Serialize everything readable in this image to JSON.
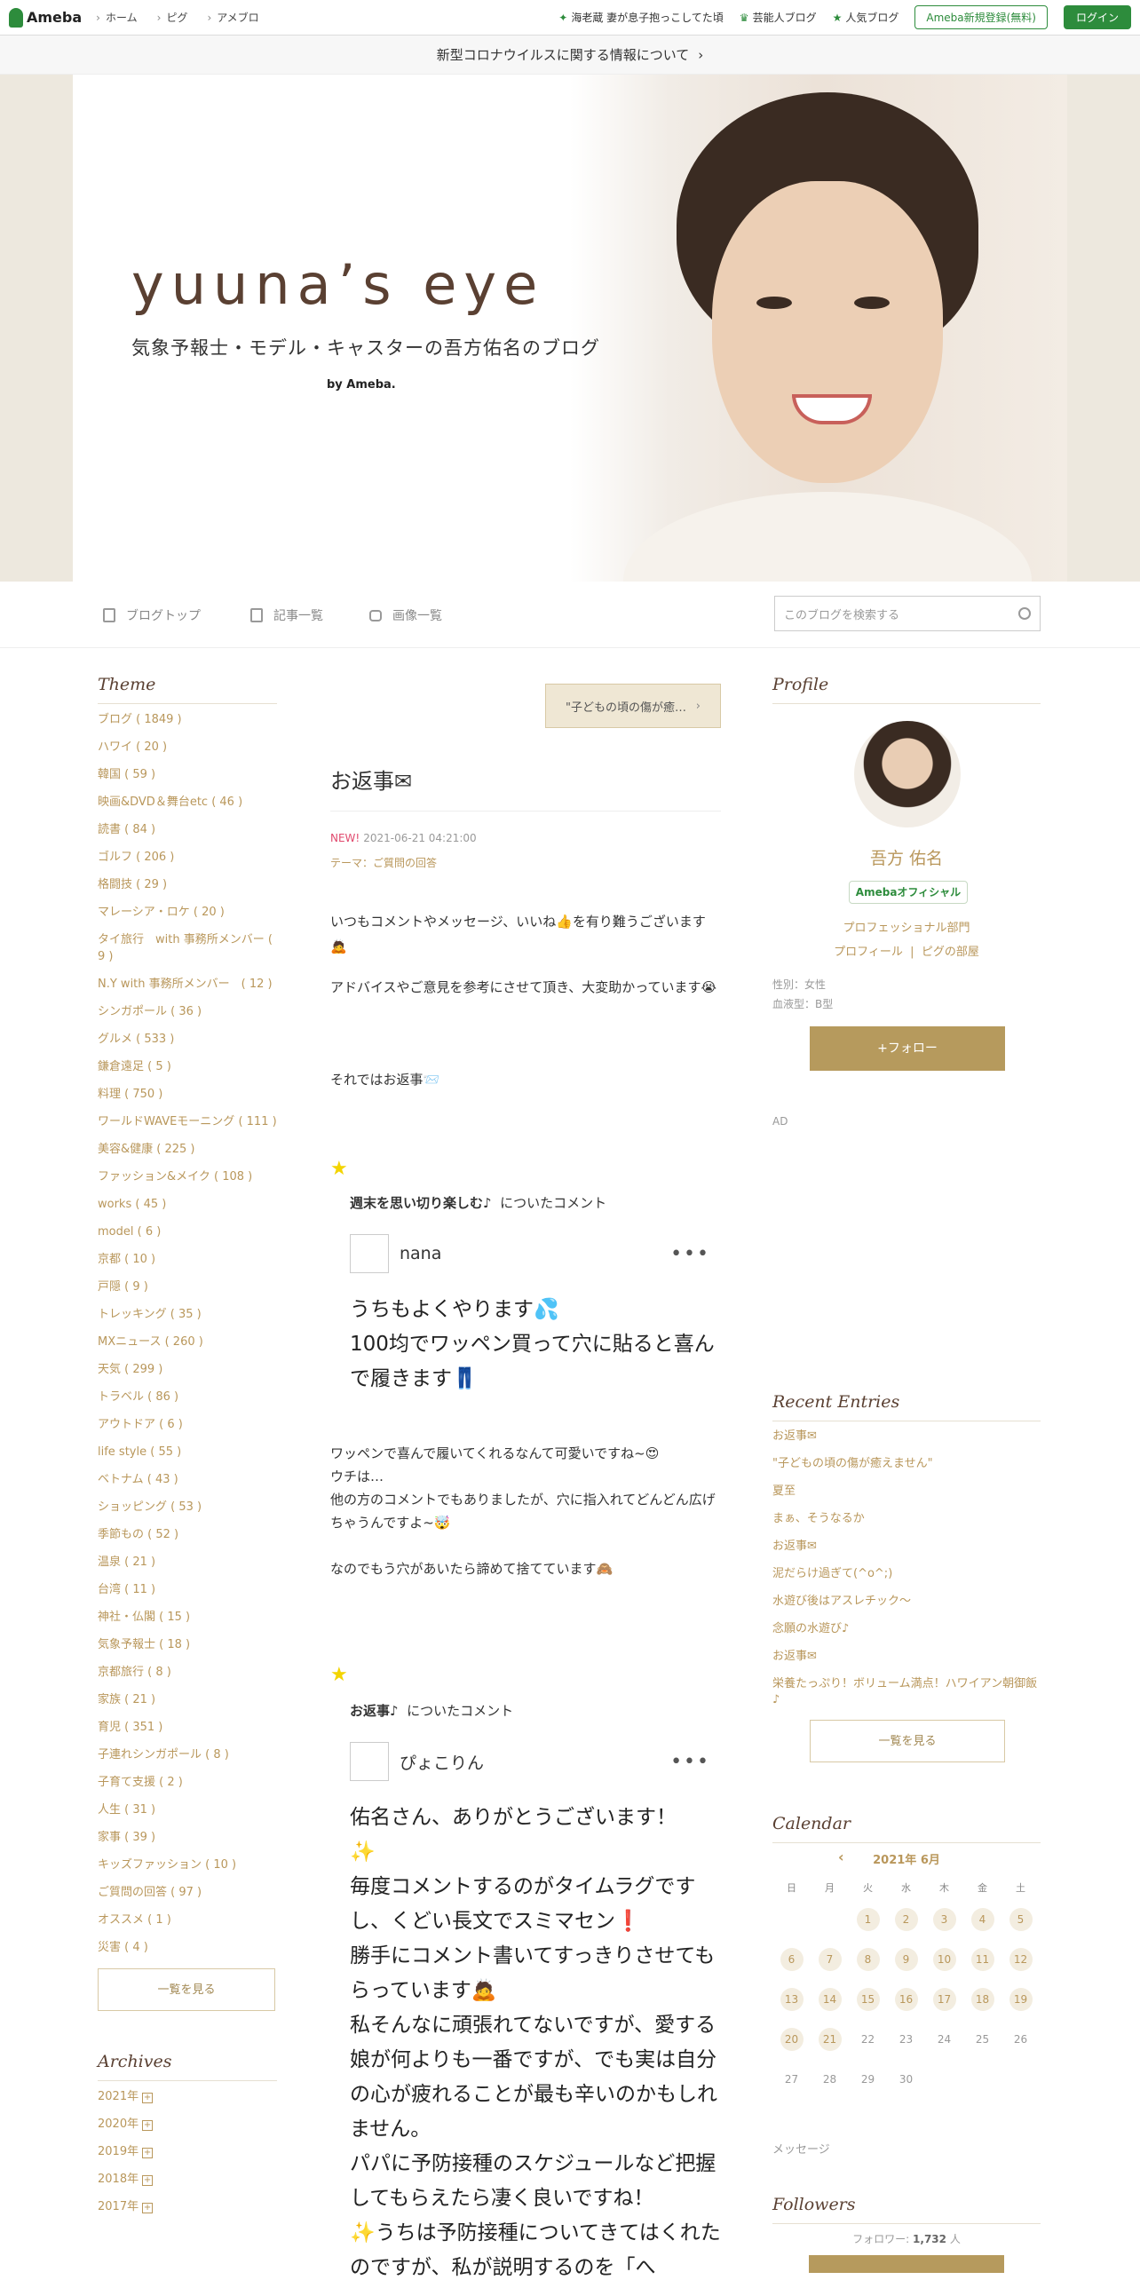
{
  "topbar": {
    "logo": "Ameba",
    "nav": [
      "ホーム",
      "ピグ",
      "アメブロ"
    ],
    "links": [
      "海老蔵 妻が息子抱っこしてた頃",
      "芸能人ブログ",
      "人気ブログ"
    ],
    "register": "Ameba新規登録(無料)",
    "login": "ログイン"
  },
  "notice": "新型コロナウイルスに関する情報について",
  "header": {
    "title": "yuuna’s eye",
    "subtitle": "気象予報士・モデル・キャスターの吾方佑名のブログ",
    "by": "by Ameba."
  },
  "tabs": {
    "top": "ブログトップ",
    "entries": "記事一覧",
    "images": "画像一覧",
    "search_placeholder": "このブログを検索する"
  },
  "theme": {
    "heading": "Theme",
    "items": [
      "ブログ ( 1849 )",
      "ハワイ ( 20 )",
      "韓国 ( 59 )",
      "映画&DVD＆舞台etc ( 46 )",
      "読書 ( 84 )",
      "ゴルフ ( 206 )",
      "格闘技 ( 29 )",
      "マレーシア・ロケ ( 20 )",
      "タイ旅行　with 事務所メンバー ( 9 )",
      "N.Y with 事務所メンバー　( 12 )",
      "シンガポール ( 36 )",
      "グルメ ( 533 )",
      "鎌倉遠足 ( 5 )",
      "料理 ( 750 )",
      "ワールドWAVEモーニング ( 111 )",
      "美容&健康 ( 225 )",
      "ファッション&メイク ( 108 )",
      "works ( 45 )",
      "model ( 6 )",
      "京都 ( 10 )",
      "戸隠 ( 9 )",
      "トレッキング ( 35 )",
      "MXニュース ( 260 )",
      "天気 ( 299 )",
      "トラベル ( 86 )",
      "アウトドア ( 6 )",
      "life style ( 55 )",
      "ベトナム ( 43 )",
      "ショッピング ( 53 )",
      "季節もの ( 52 )",
      "温泉 ( 21 )",
      "台湾 ( 11 )",
      "神社・仏閣 ( 15 )",
      "気象予報士 ( 18 )",
      "京都旅行 ( 8 )",
      "家族 ( 21 )",
      "育児 ( 351 )",
      "子連れシンガポール ( 8 )",
      "子育て支援 ( 2 )",
      "人生 ( 31 )",
      "家事 ( 39 )",
      "キッズファッション ( 10 )",
      "ご質問の回答 ( 97 )",
      "オススメ ( 1 )",
      "災害 ( 4 )"
    ],
    "more": "一覧を見る"
  },
  "archives": {
    "heading": "Archives",
    "items": [
      "2021年",
      "2020年",
      "2019年",
      "2018年",
      "2017年"
    ]
  },
  "post": {
    "prev": "\"子どもの頃の傷が癒…",
    "title": "お返事✉",
    "new": "NEW!",
    "date": "2021-06-21 04:21:00",
    "theme": "テーマ：ご質問の回答",
    "p1": "いつもコメントやメッセージ、いいね👍を有り難うございます🙇",
    "p2": "アドバイスやご意見を参考にさせて頂き、大変助かっています😭",
    "p3": "それではお返事📨",
    "c1": {
      "head_bold": "週末を思い切り楽しむ♪",
      "head_rest": "についたコメント",
      "user": "nana",
      "text": "うちもよくやります💦\n100均でワッペン買って穴に貼ると喜んで履きます👖"
    },
    "r1": "ワッペンで喜んで履いてくれるなんて可愛いですね~😍\nウチは…\n他の方のコメントでもありましたが、穴に指入れてどんどん広げちゃうんですよ~🤯\n\nなのでもう穴があいたら諦めて捨てています🙈",
    "c2": {
      "head_bold": "お返事♪",
      "head_rest": "についたコメント",
      "user": "ぴょこりん",
      "text": "佑名さん、ありがとうございます！\n✨\n毎度コメントするのがタイムラグですし、くどい長文でスミマセン❗\n勝手にコメント書いてすっきりさせてもらっています🙇\n私そんなに頑張れてないですが、愛する娘が何よりも一番ですが、でも実は自分の心が疲れることが最も辛いのかもしれません。\nパパに予防接種のスケジュールなど把握してもらえたら凄く良いですね！\n✨うちは予防接種についてきてはくれたのですが、私が説明するのを「へ"
    }
  },
  "profile": {
    "heading": "Profile",
    "name": "吾方 佑名",
    "badge": "Amebaオフィシャル",
    "section": "プロフェッショナル部門",
    "profile_link": "プロフィール",
    "pig_link": "ピグの部屋",
    "gender": "性別：女性",
    "blood": "血液型：B型",
    "follow": "+フォロー",
    "ad": "AD"
  },
  "recent": {
    "heading": "Recent Entries",
    "items": [
      "お返事✉",
      "\"子どもの頃の傷が癒えません\"",
      "夏至",
      "まぁ、そうなるか",
      "お返事✉",
      "泥だらけ過ぎて(^o^;)",
      "水遊び後はアスレチック～",
      "念願の水遊び♪",
      "お返事✉",
      "栄養たっぷり！ボリューム満点！ハワイアン朝御飯♪"
    ],
    "more": "一覧を見る"
  },
  "calendar": {
    "heading": "Calendar",
    "month": "2021年 6月",
    "dow": [
      "日",
      "月",
      "火",
      "水",
      "木",
      "金",
      "土"
    ],
    "days": [
      "",
      "",
      "1",
      "2",
      "3",
      "4",
      "5",
      "6",
      "7",
      "8",
      "9",
      "10",
      "11",
      "12",
      "13",
      "14",
      "15",
      "16",
      "17",
      "18",
      "19",
      "20",
      "21",
      "22",
      "23",
      "24",
      "25",
      "26",
      "27",
      "28",
      "29",
      "30",
      "",
      "",
      ""
    ],
    "has_entries": [
      1,
      2,
      3,
      4,
      5,
      6,
      7,
      8,
      9,
      10,
      11,
      12,
      13,
      14,
      15,
      16,
      17,
      18,
      19,
      20,
      21
    ]
  },
  "message": "メッセージ",
  "followers": {
    "heading": "Followers",
    "label": "フォロワー:",
    "count": "1,732",
    "unit": "人"
  }
}
